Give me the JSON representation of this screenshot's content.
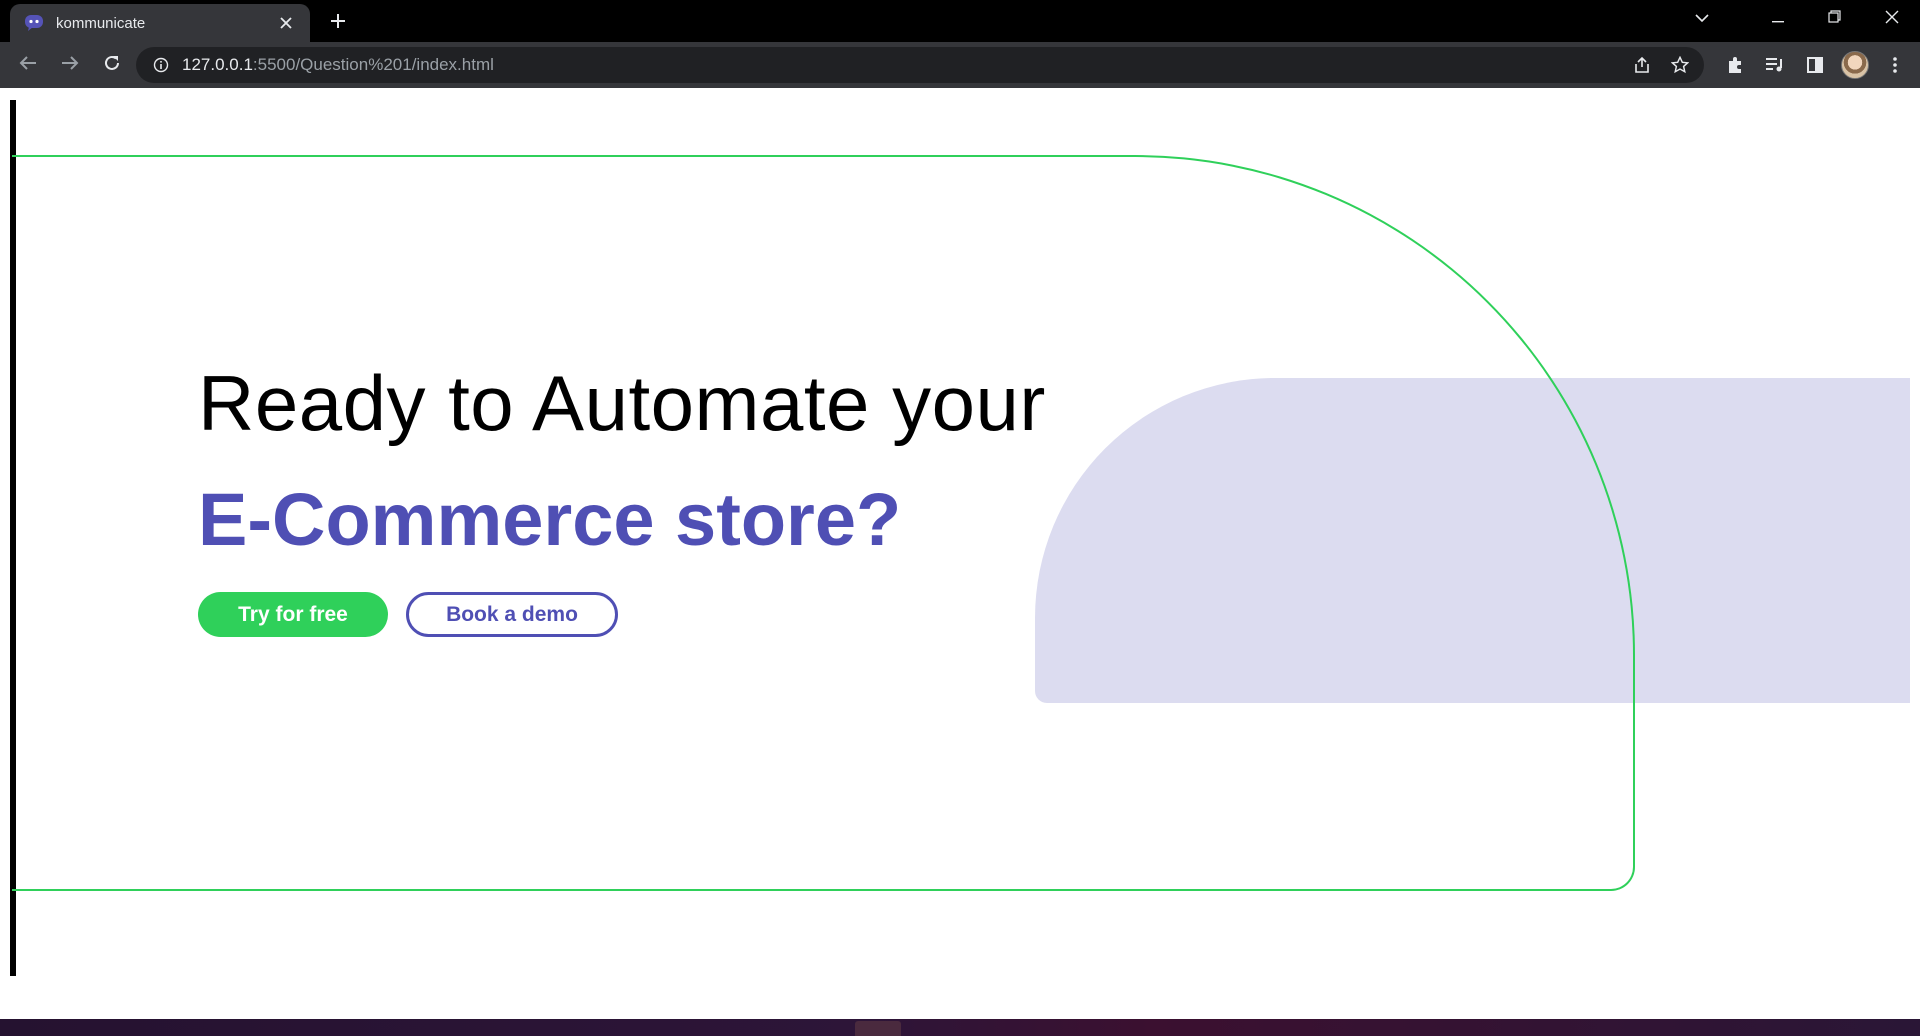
{
  "browser": {
    "tab": {
      "title": "kommunicate"
    },
    "url": {
      "host": "127.0.0.1",
      "rest": ":5500/Question%201/index.html"
    },
    "icons": {
      "favicon": "kommunicate-chat-icon",
      "tab_close": "close-icon",
      "new_tab": "plus-icon",
      "tab_search": "chevron-down-icon",
      "minimize": "minimize-icon",
      "restore": "restore-icon",
      "close_window": "close-icon",
      "back": "arrow-left-icon",
      "forward": "arrow-right-icon",
      "reload": "reload-icon",
      "site_info": "info-icon",
      "share": "share-icon",
      "bookmark": "star-icon",
      "extensions": "puzzle-icon",
      "media": "media-queue-icon",
      "side_panel": "side-panel-icon",
      "profile": "avatar",
      "menu": "kebab-menu-icon"
    }
  },
  "hero": {
    "headline_line1": "Ready to Automate your",
    "headline_line2": "E-Commerce store?",
    "primary_cta": "Try for free",
    "secondary_cta": "Book a demo"
  },
  "colors": {
    "accent_green": "#2fd05a",
    "accent_purple": "#4f4fb4",
    "shape_lavender": "#dcdcf0",
    "chrome_dark": "#35363a"
  }
}
